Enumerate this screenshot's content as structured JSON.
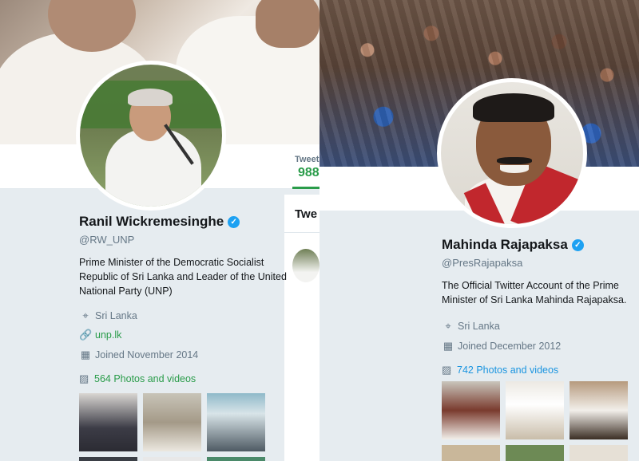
{
  "left_profile": {
    "name": "Ranil Wickremesinghe",
    "handle": "@RW_UNP",
    "bio": "Prime Minister of the Democratic Socialist Republic of Sri Lanka and Leader of the United National Party (UNP)",
    "location": "Sri Lanka",
    "website": "unp.lk",
    "joined": "Joined November 2014",
    "photos_label": "564 Photos and videos",
    "nav": {
      "tweets_label": "Tweets",
      "tweets_count": "988"
    },
    "timeline_header": "Twe",
    "accent_color": "#2a9c4a",
    "verified_icon": "verified-badge-icon"
  },
  "right_profile": {
    "name": "Mahinda Rajapaksa",
    "handle": "@PresRajapaksa",
    "bio": "The Official Twitter Account of the Prime Minister of Sri Lanka Mahinda Rajapaksa.",
    "location": "Sri Lanka",
    "joined": "Joined December 2012",
    "photos_label": "742 Photos and videos",
    "accent_color": "#1b95e0",
    "verified_icon": "verified-badge-icon"
  },
  "icons": {
    "location": "location-pin-icon",
    "link": "link-icon",
    "calendar": "calendar-icon",
    "photos": "image-icon"
  }
}
